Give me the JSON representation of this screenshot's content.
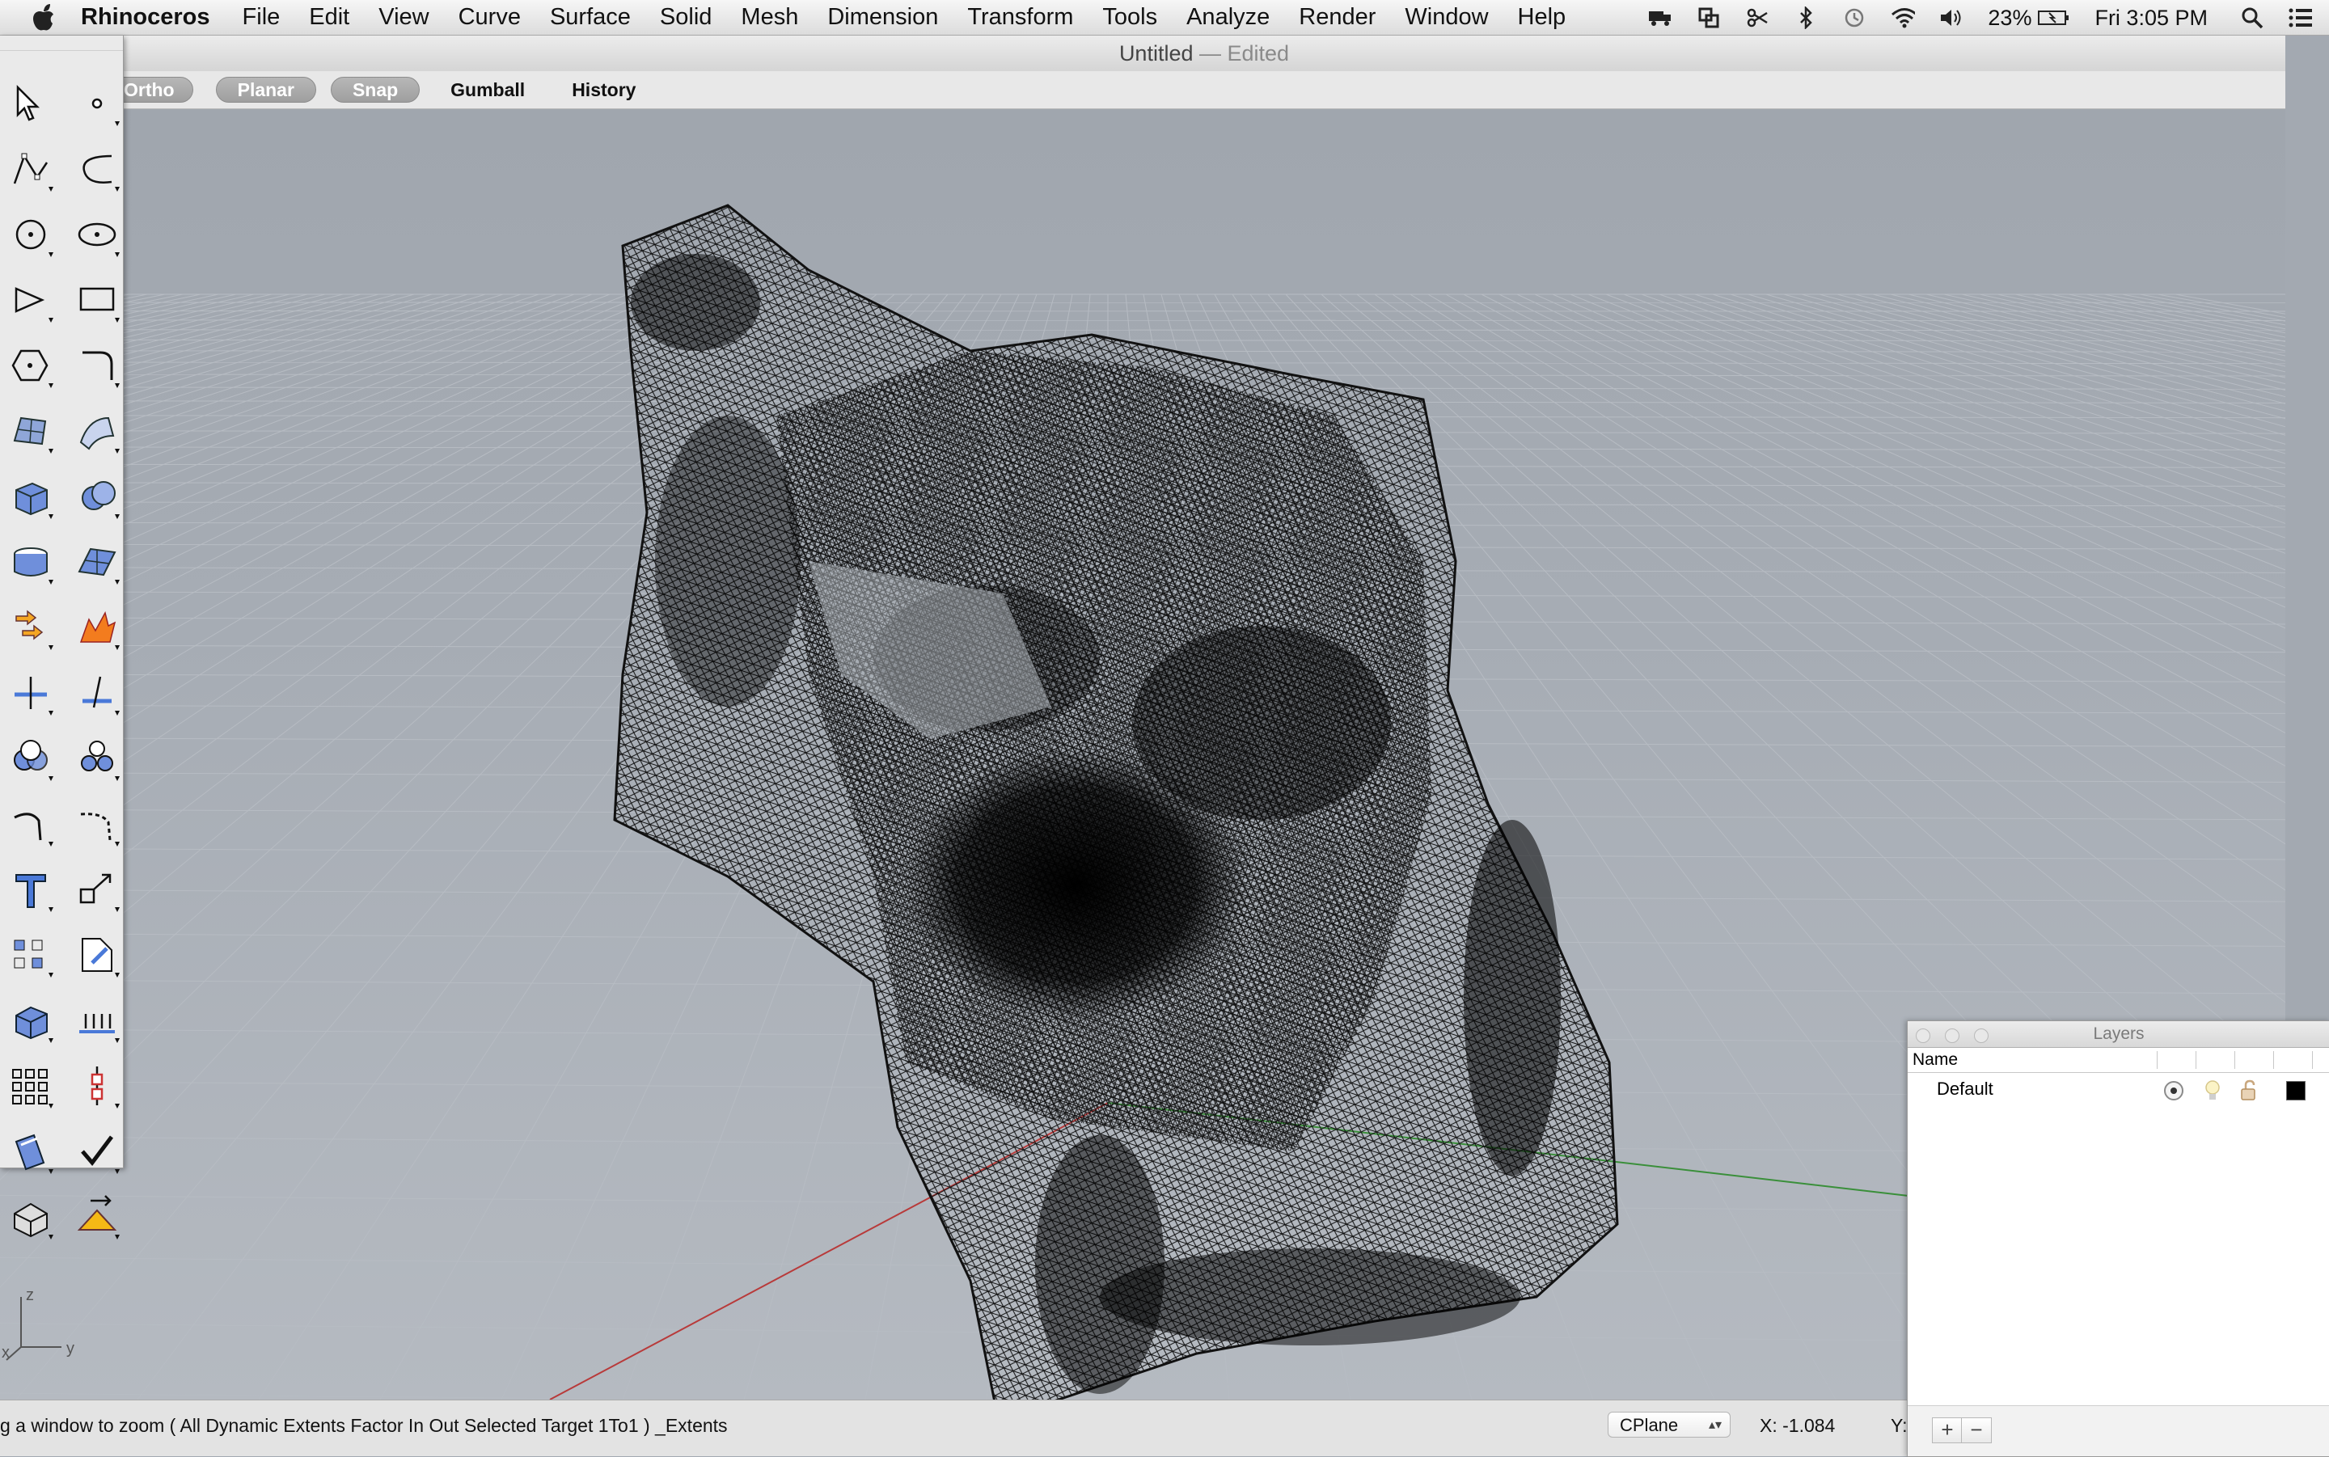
{
  "menubar": {
    "app_name": "Rhinoceros",
    "items": [
      "File",
      "Edit",
      "View",
      "Curve",
      "Surface",
      "Solid",
      "Mesh",
      "Dimension",
      "Transform",
      "Tools",
      "Analyze",
      "Render",
      "Window",
      "Help"
    ],
    "battery": "23%",
    "clock": "Fri 3:05 PM",
    "status_icons": [
      "truck-icon",
      "sync-icon",
      "scissors-icon",
      "bluetooth-icon",
      "time-machine-icon",
      "wifi-icon",
      "volume-icon",
      "battery-icon",
      "spotlight-icon",
      "notification-list-icon"
    ]
  },
  "window": {
    "title": "Untitled",
    "title_sep": " — ",
    "title_state": "Edited"
  },
  "modebar": {
    "ortho": "Ortho",
    "planar": "Planar",
    "snap": "Snap",
    "gumball": "Gumball",
    "history": "History"
  },
  "viewport": {
    "axis_z": "z",
    "axis_y": "y",
    "axis_x": "x",
    "x_axis_color": "#b83a3a",
    "y_axis_color": "#3a8f3a"
  },
  "toolbox": {
    "tools": [
      "select-arrow-icon",
      "point-icon",
      "polyline-icon",
      "curve-icon",
      "circle-icon",
      "ellipse-icon",
      "arc-icon",
      "rectangle-icon",
      "polygon-icon",
      "fillet-curve-icon",
      "surface-from-points-icon",
      "surface-edit-icon",
      "box-icon",
      "sphere-icon",
      "cylinder-icon",
      "plane-surface-icon",
      "join-icon",
      "explode-icon",
      "trim-icon",
      "split-icon",
      "boolean-union-icon",
      "boolean-split-icon",
      "fillet-icon",
      "chamfer-icon",
      "text-icon",
      "scale-icon",
      "array-icon",
      "transform-icon",
      "extrude-solid-icon",
      "grid-icon",
      "array-grid-icon",
      "gumball-icon",
      "analyze-icon",
      "check-icon",
      "render-icon",
      "light-icon"
    ]
  },
  "statusbar": {
    "prompt": "g a window to zoom ( All Dynamic Extents Factor In Out Selected Target 1To1 ) _Extents",
    "cplane": "CPlane",
    "coord_x": "X: -1.084",
    "coord_y": "Y:"
  },
  "layers": {
    "title": "Layers",
    "column_name": "Name",
    "rows": [
      {
        "name": "Default",
        "color": "#000000"
      }
    ],
    "add_label": "+",
    "remove_label": "−"
  }
}
